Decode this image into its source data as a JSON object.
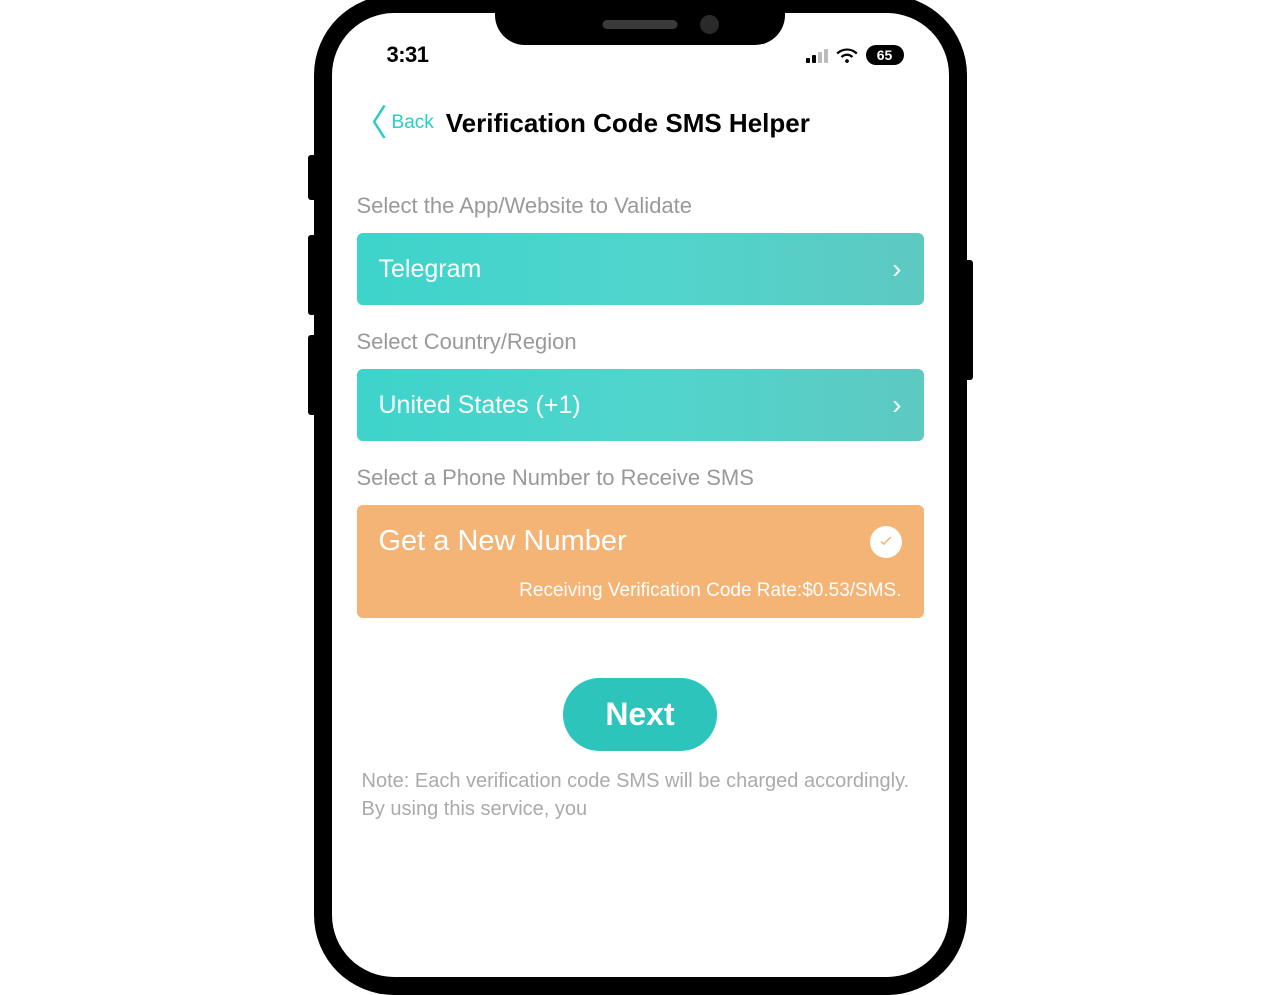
{
  "status_bar": {
    "time": "3:31",
    "battery": "65"
  },
  "nav": {
    "back_label": "Back",
    "title": "Verification Code SMS Helper"
  },
  "sections": {
    "app": {
      "label": "Select the App/Website to Validate",
      "value": "Telegram"
    },
    "country": {
      "label": "Select Country/Region",
      "value": "United States (+1)"
    },
    "phone": {
      "label": "Select a Phone Number to Receive SMS",
      "title": "Get a New Number",
      "subtitle": "Receiving Verification Code Rate:$0.53/SMS."
    }
  },
  "next_button": "Next",
  "note": "Note: Each verification code SMS will be charged accordingly. By using this service, you"
}
